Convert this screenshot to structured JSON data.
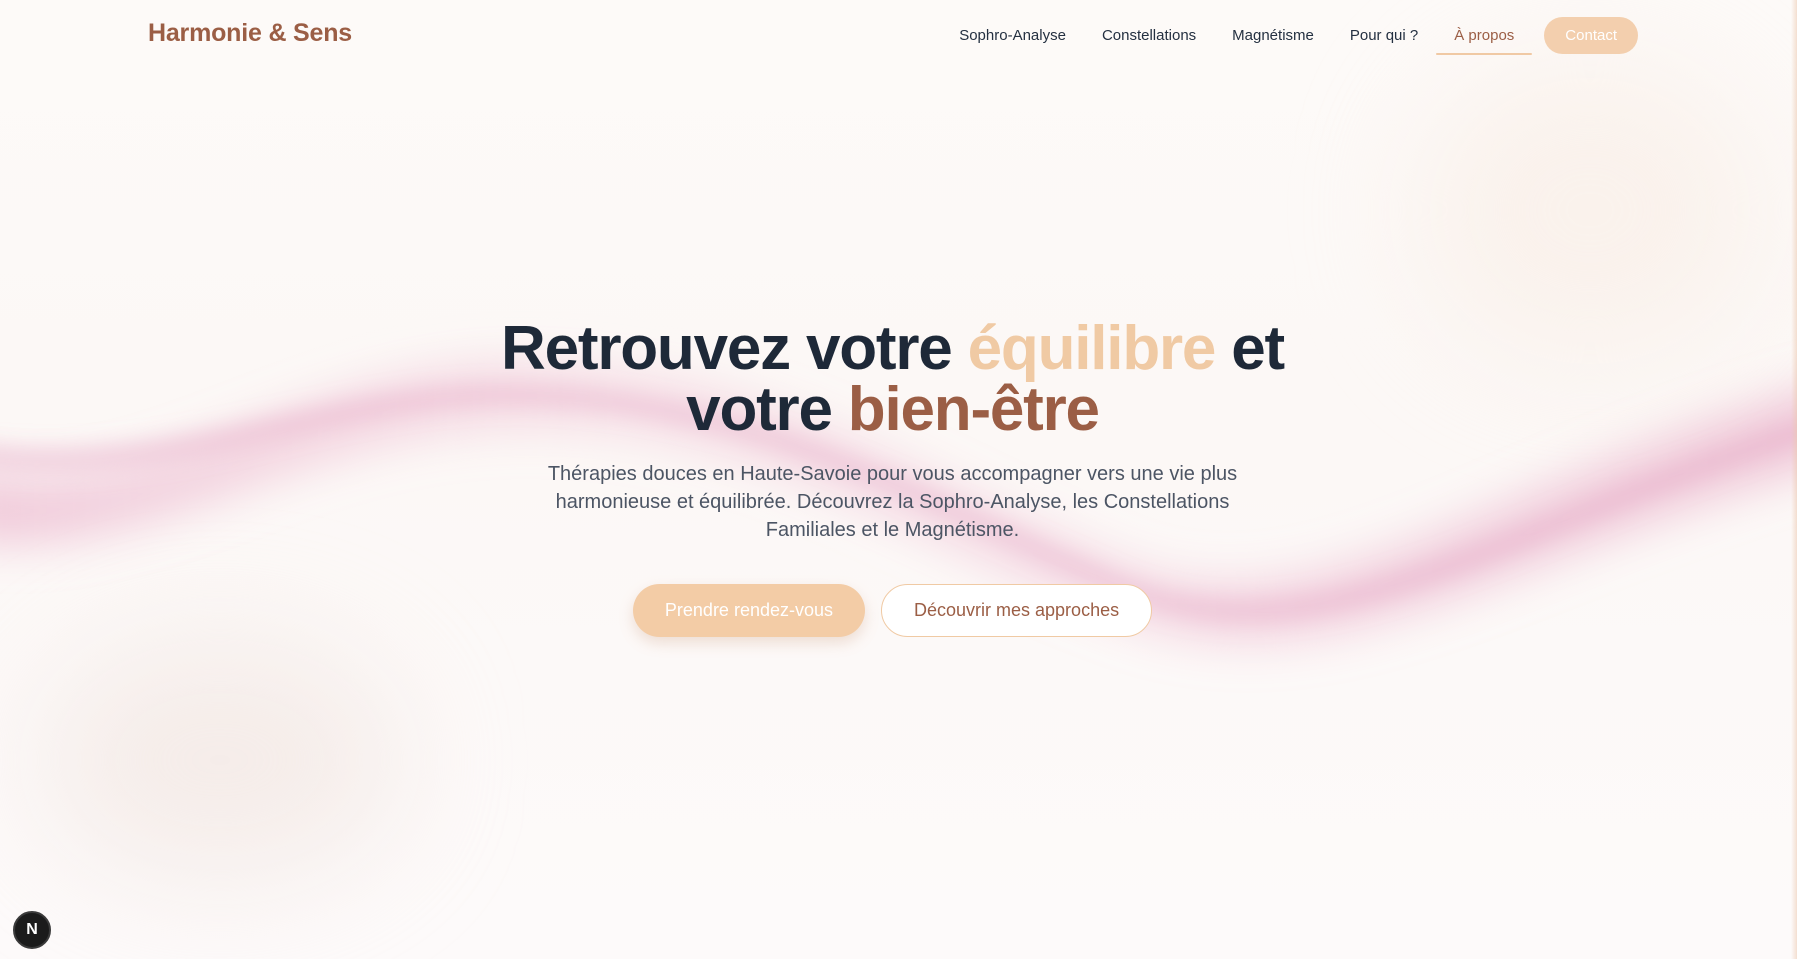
{
  "header": {
    "brand": "Harmonie & Sens",
    "nav": [
      {
        "label": "Sophro-Analyse"
      },
      {
        "label": "Constellations"
      },
      {
        "label": "Magnétisme"
      },
      {
        "label": "Pour qui ?"
      },
      {
        "label": "À propos",
        "active": true
      }
    ],
    "contact_label": "Contact"
  },
  "hero": {
    "title_part1": "Retrouvez votre ",
    "title_highlight1": "équilibre",
    "title_part2": " et votre ",
    "title_highlight2": "bien-être",
    "subtitle": "Thérapies douces en Haute-Savoie pour vous accompagner vers une vie plus harmonieuse et équilibrée. Découvrez la Sophro-Analyse, les Constellations Familiales et le Magnétisme.",
    "primary_button": "Prendre rendez-vous",
    "secondary_button": "Découvrir mes approches"
  },
  "dev_badge": "N",
  "colors": {
    "brand": "#9b5e45",
    "accent_light": "#f3cca6",
    "heading": "#1e2938",
    "wave": "#e8a9c6"
  }
}
